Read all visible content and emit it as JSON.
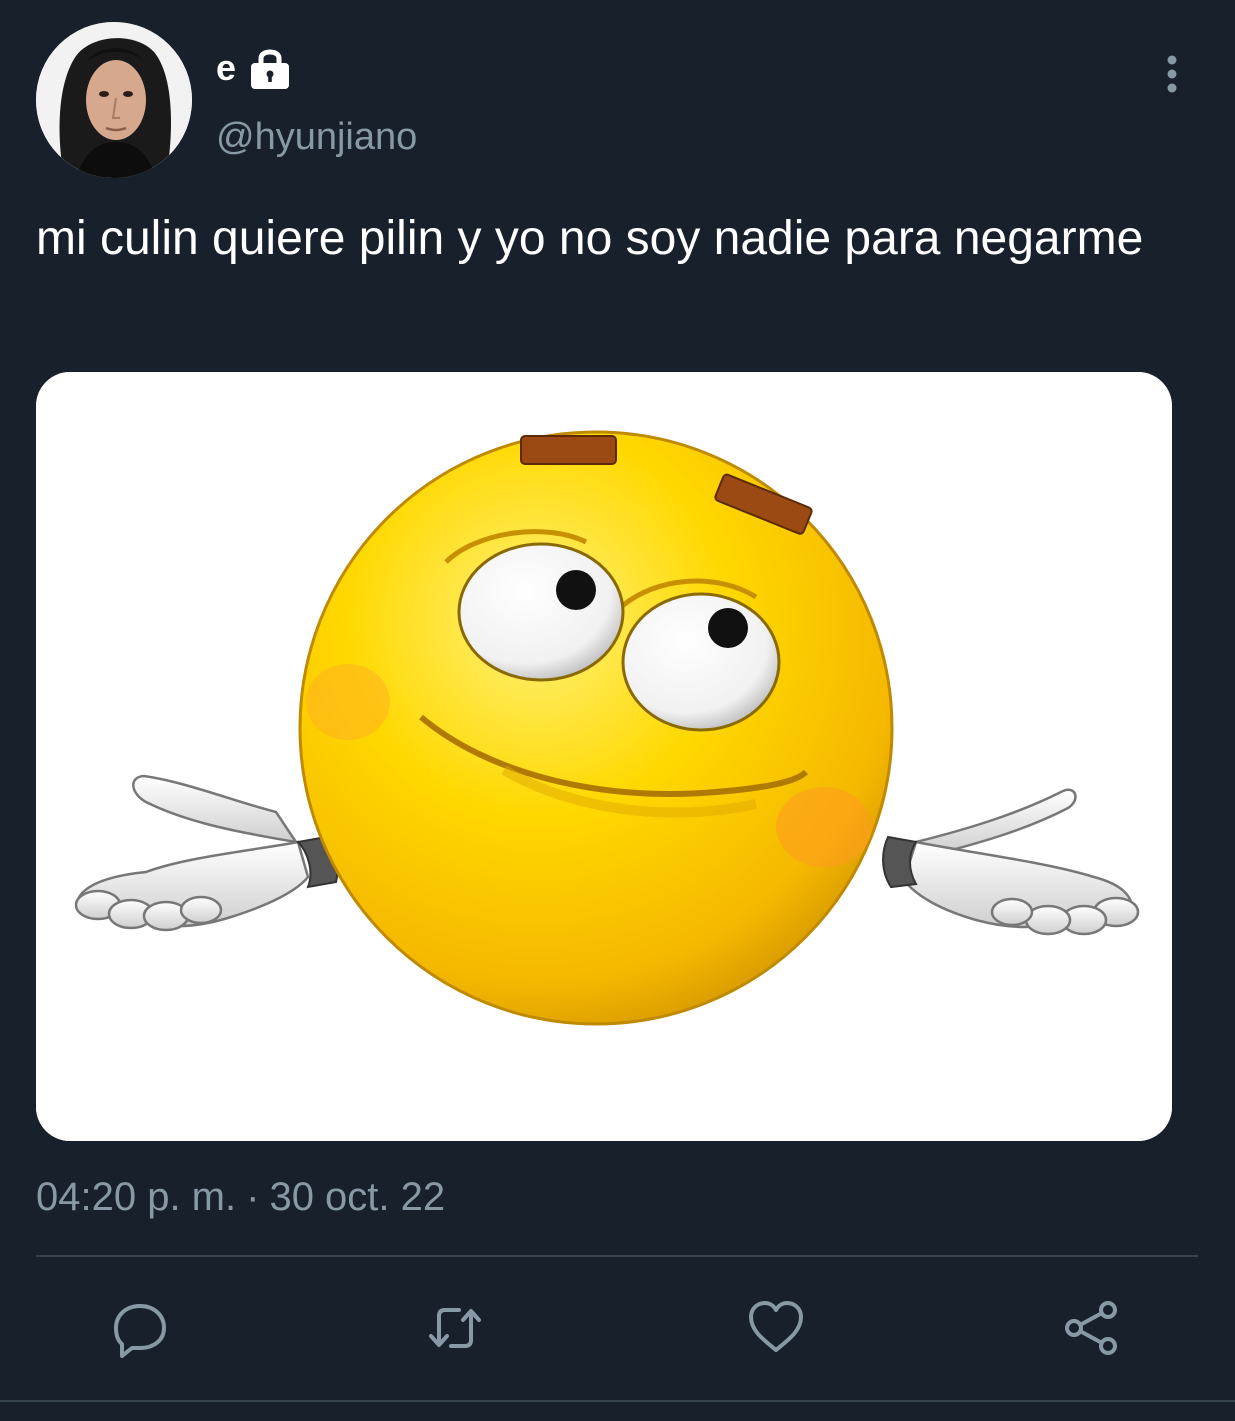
{
  "tweet": {
    "display_name": "e",
    "handle": "@hyunjiano",
    "text": "mi culin quiere pilin y yo no soy nadie para negarme",
    "time": "04:20 p. m.",
    "separator": "·",
    "date": "30 oct. 22"
  },
  "icons": {
    "lock": "lock-icon",
    "more": "more-vertical-icon",
    "reply": "reply-icon",
    "retweet": "retweet-icon",
    "like": "heart-icon",
    "share": "share-icon"
  },
  "colors": {
    "background": "#17202b",
    "text_primary": "#ffffff",
    "text_secondary": "#8899a6",
    "divider": "#38444d",
    "icon": "#8899a6"
  }
}
